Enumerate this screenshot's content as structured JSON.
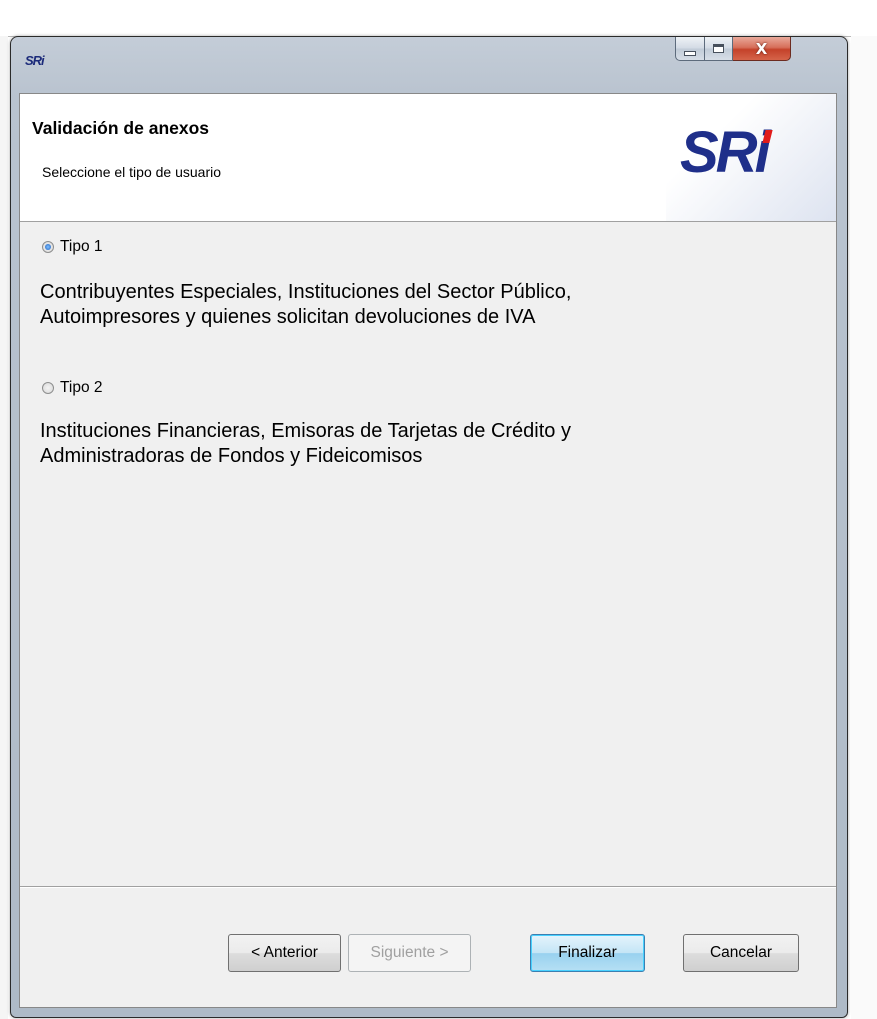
{
  "window": {
    "icon_text": "SRi",
    "close_glyph": "X"
  },
  "header": {
    "title": "Validación de anexos",
    "subtitle": "Seleccione el tipo de usuario",
    "logo_text": "SRi"
  },
  "options": [
    {
      "label": "Tipo 1",
      "selected": true,
      "description_line1": "Contribuyentes Especiales, Instituciones del Sector Público,",
      "description_line2": "Autoimpresores y quienes  solicitan devoluciones de IVA"
    },
    {
      "label": "Tipo 2",
      "selected": false,
      "description_line1": "Instituciones Financieras, Emisoras de Tarjetas de Crédito y",
      "description_line2": "Administradoras de Fondos y Fideicomisos"
    }
  ],
  "buttons": {
    "back": "< Anterior",
    "next": "Siguiente >",
    "finish": "Finalizar",
    "cancel": "Cancelar"
  },
  "colors": {
    "logo_blue": "#1f2f8a",
    "logo_accent_red": "#e01b1b",
    "close_button_red": "#c4422a",
    "default_button_blue": "#98d1ef"
  },
  "icons": [
    "sri-app-icon",
    "minimize-icon",
    "maximize-icon",
    "close-icon",
    "radio-checked-icon",
    "radio-unchecked-icon"
  ]
}
